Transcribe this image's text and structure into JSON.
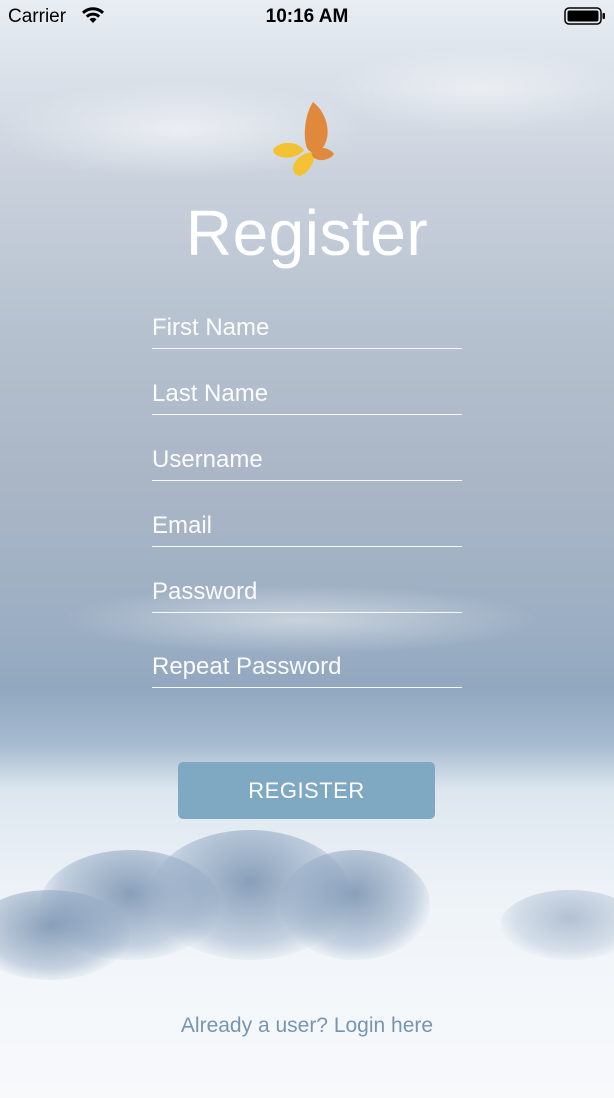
{
  "status_bar": {
    "carrier": "Carrier",
    "time": "10:16 AM",
    "wifi_icon": "wifi-icon",
    "battery_icon": "battery-icon"
  },
  "logo": {
    "icon": "butterfly-logo-icon",
    "colors": [
      "#e0893c",
      "#f2c232"
    ]
  },
  "title": "Register",
  "form": {
    "first_name": {
      "placeholder": "First Name",
      "value": ""
    },
    "last_name": {
      "placeholder": "Last Name",
      "value": ""
    },
    "username": {
      "placeholder": "Username",
      "value": ""
    },
    "email": {
      "placeholder": "Email",
      "value": ""
    },
    "password": {
      "placeholder": "Password",
      "value": ""
    },
    "repeat_password": {
      "placeholder": "Repeat Password",
      "value": ""
    }
  },
  "register_button_label": "REGISTER",
  "login_link": "Already a user? Login here",
  "colors": {
    "button": "#7fa8c3",
    "link": "#7895b0",
    "text_light": "#ffffff"
  }
}
